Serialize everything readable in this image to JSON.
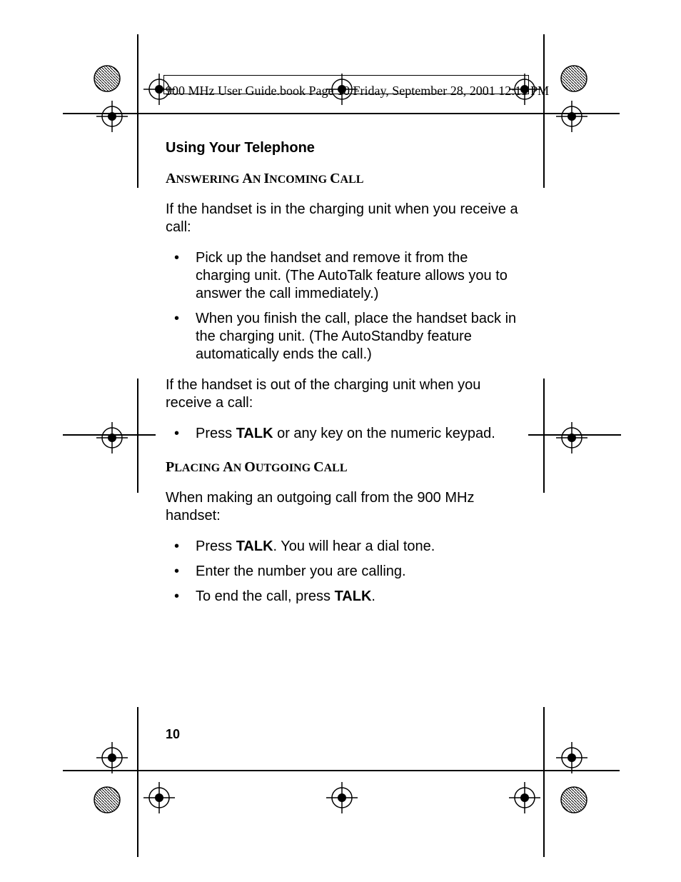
{
  "header": {
    "line": "900 MHz User Guide.book  Page 10  Friday, September 28, 2001  12:11 PM"
  },
  "content": {
    "section_title": "Using Your Telephone",
    "h1_parts": [
      "A",
      "NSWERING ",
      "A",
      "N ",
      "I",
      "NCOMING ",
      "C",
      "ALL"
    ],
    "p1": "If the handset is in the charging unit when you receive a call:",
    "list1": [
      "Pick up the handset and remove it from the charging unit. (The AutoTalk feature allows you to answer the call immediately.)",
      "When you finish the call, place the handset back in the charging unit. (The AutoStandby feature automatically ends the call.)"
    ],
    "p2": "If the handset is out of the charging unit when you receive a call:",
    "list2_pre": "Press ",
    "list2_bold": "TALK",
    "list2_post": " or any key on the numeric keypad.",
    "h2_parts": [
      "P",
      "LACING ",
      "A",
      "N ",
      "O",
      "UTGOING ",
      "C",
      "ALL"
    ],
    "p3": "When making an outgoing call from the 900 MHz handset:",
    "list3": [
      {
        "pre": "Press ",
        "bold": "TALK",
        "post": ".  You will hear a dial tone."
      },
      {
        "pre": "Enter the number you are calling.",
        "bold": "",
        "post": ""
      },
      {
        "pre": "To end the call, press ",
        "bold": "TALK",
        "post": "."
      }
    ]
  },
  "page_number": "10"
}
